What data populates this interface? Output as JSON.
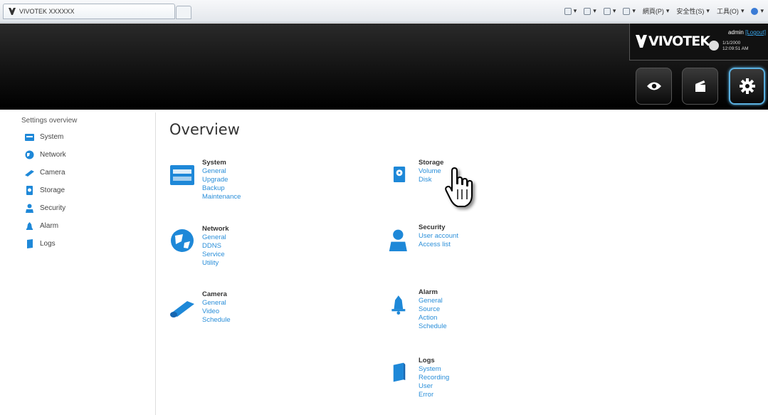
{
  "browser": {
    "tab_title": "VIVOTEK XXXXXX",
    "commands": [
      "網頁(P)",
      "安全性(S)",
      "工具(O)"
    ]
  },
  "header": {
    "brand": "VIVOTEK",
    "user": "admin",
    "logout_label": "[Logout]",
    "date": "1/1/2000",
    "time": "12:09:51 AM"
  },
  "sidebar": {
    "title": "Settings overview",
    "items": [
      {
        "label": "System",
        "icon": "system-icon"
      },
      {
        "label": "Network",
        "icon": "network-icon"
      },
      {
        "label": "Camera",
        "icon": "camera-icon"
      },
      {
        "label": "Storage",
        "icon": "storage-icon"
      },
      {
        "label": "Security",
        "icon": "security-icon"
      },
      {
        "label": "Alarm",
        "icon": "alarm-icon"
      },
      {
        "label": "Logs",
        "icon": "logs-icon"
      }
    ]
  },
  "main": {
    "title": "Overview",
    "groups": {
      "system": {
        "title": "System",
        "links": [
          "General",
          "Upgrade",
          "Backup",
          "Maintenance"
        ]
      },
      "network": {
        "title": "Network",
        "links": [
          "General",
          "DDNS",
          "Service",
          "Utility"
        ]
      },
      "camera": {
        "title": "Camera",
        "links": [
          "General",
          "Video",
          "Schedule"
        ]
      },
      "storage": {
        "title": "Storage",
        "links": [
          "Volume",
          "Disk"
        ]
      },
      "security": {
        "title": "Security",
        "links": [
          "User account",
          "Access list"
        ]
      },
      "alarm": {
        "title": "Alarm",
        "links": [
          "General",
          "Source",
          "Action",
          "Schedule"
        ]
      },
      "logs": {
        "title": "Logs",
        "links": [
          "System",
          "Recording",
          "User",
          "Error"
        ]
      }
    }
  },
  "colors": {
    "accent": "#2b8fd9",
    "header": "#000000",
    "active_border": "#5ab0e0"
  }
}
